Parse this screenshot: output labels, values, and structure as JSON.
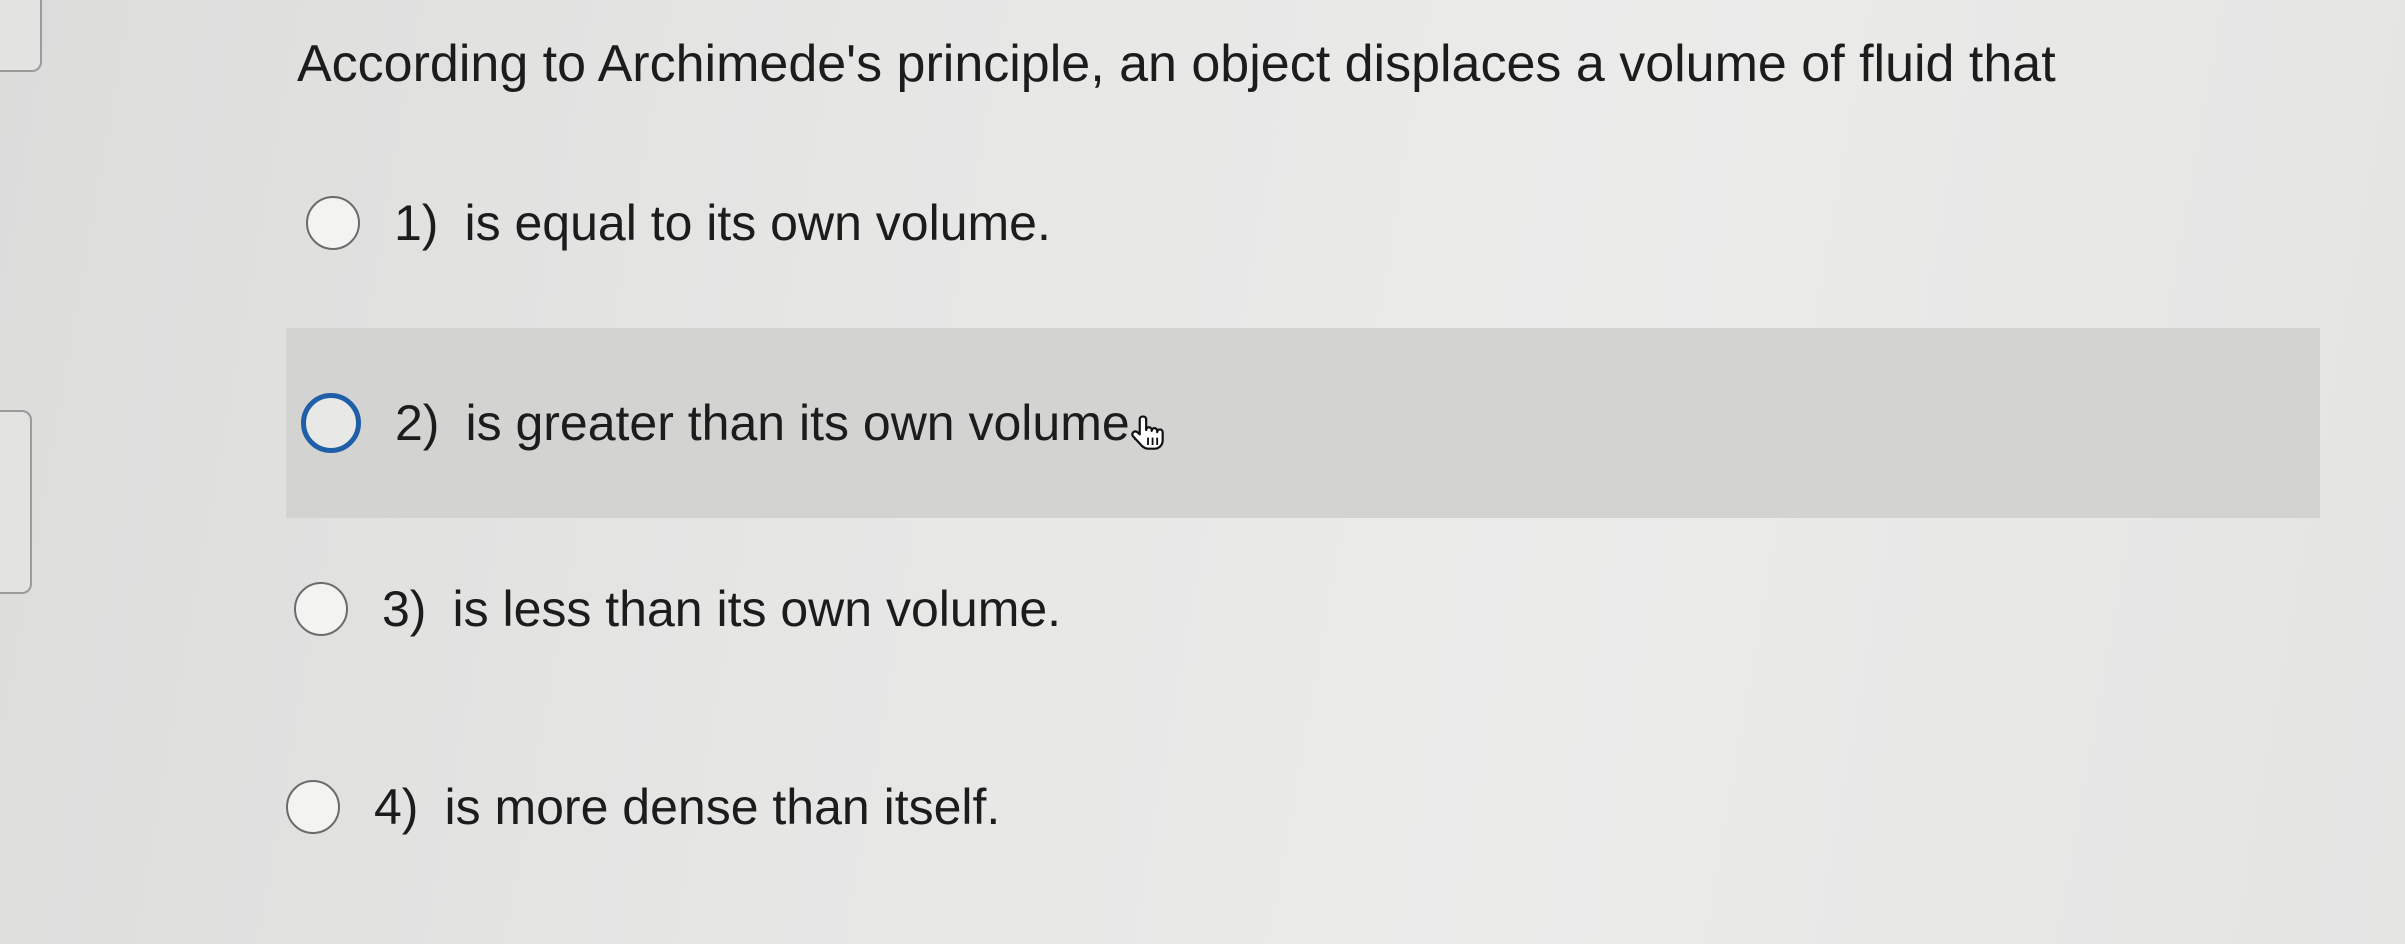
{
  "question": {
    "text": "According to Archimede's principle, an object displaces a volume of fluid that"
  },
  "options": [
    {
      "number": "1)",
      "text": "is equal to its own volume.",
      "selected": false,
      "highlighted": false
    },
    {
      "number": "2)",
      "text": "is greater than its own volume.",
      "selected": false,
      "highlighted": true
    },
    {
      "number": "3)",
      "text": "is less than its own volume.",
      "selected": false,
      "highlighted": false
    },
    {
      "number": "4)",
      "text": "is more dense than itself.",
      "selected": false,
      "highlighted": false
    }
  ],
  "colors": {
    "focus_ring": "#1f5fa8",
    "highlight_background": "#d3d3d2",
    "page_background": "#e6e6e5"
  },
  "icons": {
    "cursor": "hand-pointer-icon"
  }
}
